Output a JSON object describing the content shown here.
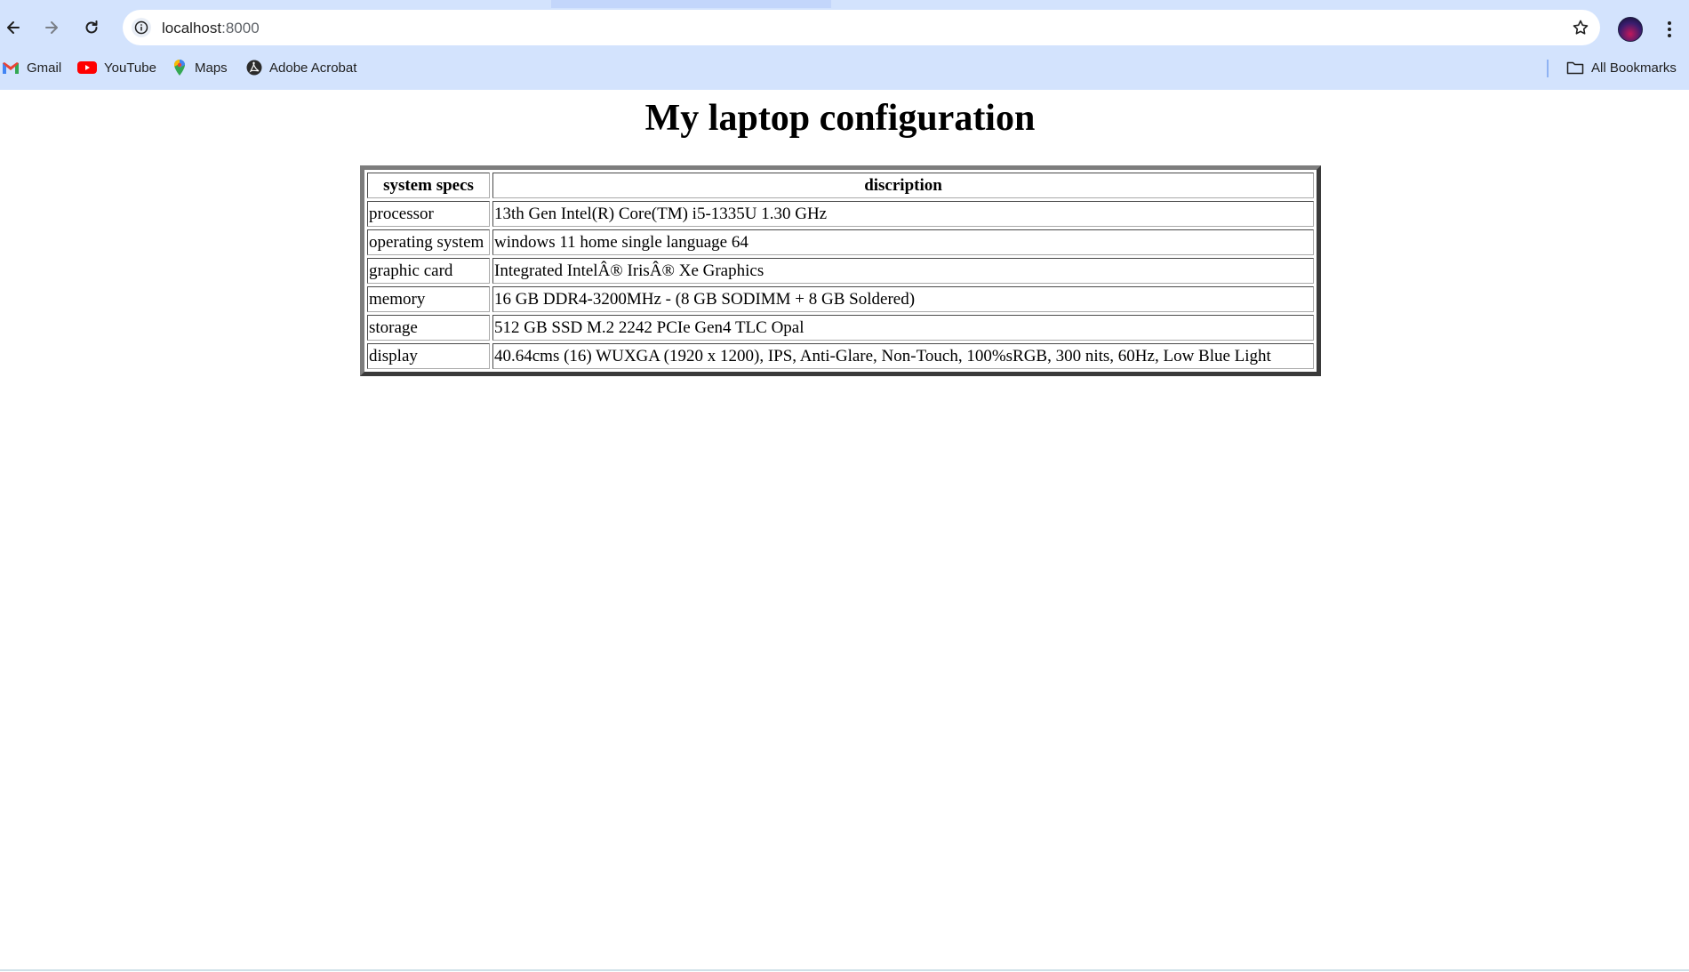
{
  "browser": {
    "url_host": "localhost",
    "url_port": ":8000",
    "bookmarks": [
      {
        "label": "Gmail",
        "icon": "gmail-icon"
      },
      {
        "label": "YouTube",
        "icon": "youtube-icon"
      },
      {
        "label": "Maps",
        "icon": "maps-icon"
      },
      {
        "label": "Adobe Acrobat",
        "icon": "acrobat-icon"
      }
    ],
    "all_bookmarks_label": "All Bookmarks"
  },
  "page": {
    "title": "My laptop configuration",
    "table": {
      "headers": [
        "system specs",
        "discription"
      ],
      "rows": [
        [
          "processor",
          "13th Gen Intel(R) Core(TM) i5-1335U 1.30 GHz"
        ],
        [
          "operating system",
          "windows 11 home single language 64"
        ],
        [
          "graphic card",
          "Integrated IntelÂ® IrisÂ® Xe Graphics"
        ],
        [
          "memory",
          "16 GB DDR4-3200MHz - (8 GB SODIMM + 8 GB Soldered)"
        ],
        [
          "storage",
          "512 GB SSD M.2 2242 PCIe Gen4 TLC Opal"
        ],
        [
          "display",
          "40.64cms (16) WUXGA (1920 x 1200), IPS, Anti-Glare, Non-Touch, 100%sRGB, 300 nits, 60Hz, Low Blue Light"
        ]
      ]
    }
  },
  "colors": {
    "chrome_bg": "#d3e3fd",
    "omnibox_bg": "#ffffff",
    "page_bg": "#ffffff"
  }
}
